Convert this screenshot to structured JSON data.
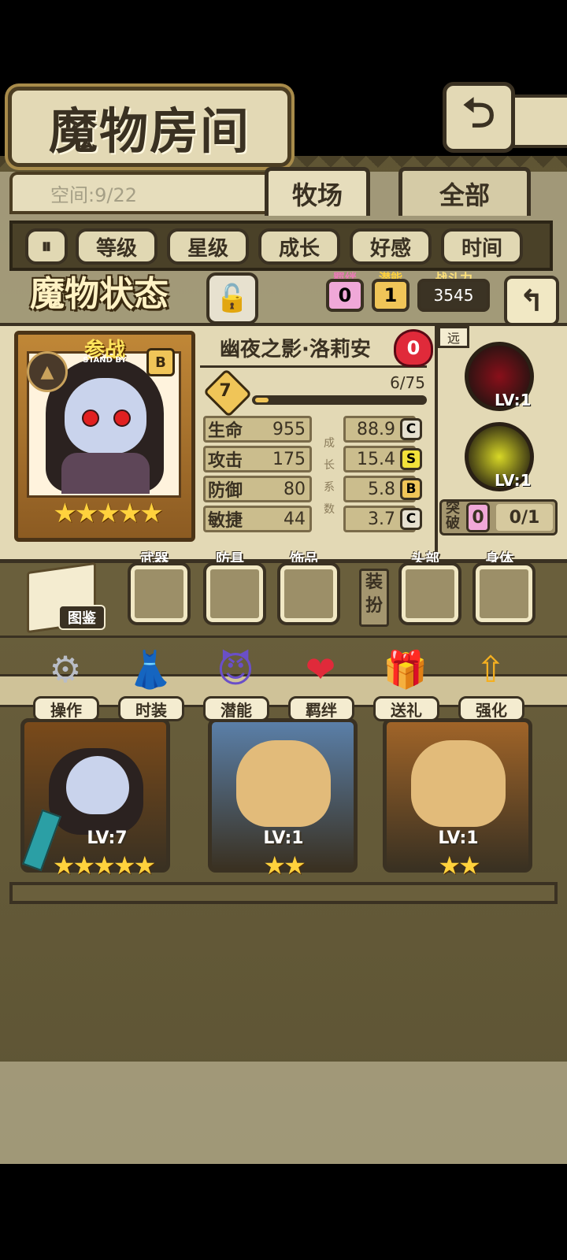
{
  "header": {
    "title": "魔物房间",
    "back_icon": "return-icon"
  },
  "room": {
    "space_label": "空间:9/22"
  },
  "tabs": [
    {
      "label": "牧场",
      "active": true
    },
    {
      "label": "全部",
      "active": false
    }
  ],
  "filters": {
    "toggle_icon": "sort-toggle-icon",
    "items": [
      "等级",
      "星级",
      "成长",
      "好感",
      "时间"
    ]
  },
  "status": {
    "title": "魔物状态",
    "bond_label": "羁绊",
    "bond_value": "0",
    "potential_label": "潜能",
    "potential_value": "1",
    "power_label": "战斗力",
    "power_value": "3545"
  },
  "monster": {
    "standby_label": "参战",
    "standby_sub": "STAND BY",
    "grade": "B",
    "name": "幽夜之影·洛莉安",
    "heart_value": "0",
    "level": "7",
    "exp_text": "6/75",
    "exp_fraction": 0.08,
    "stars": "★★★★★",
    "stats": [
      {
        "name": "生命",
        "value": "955",
        "growth": "88.9",
        "grade": "C",
        "grade_color": "#e6e0d0"
      },
      {
        "name": "攻击",
        "value": "175",
        "growth": "15.4",
        "grade": "S",
        "grade_color": "#f2e23a"
      },
      {
        "name": "防御",
        "value": "80",
        "growth": "5.8",
        "grade": "B",
        "grade_color": "#f0c558"
      },
      {
        "name": "敏捷",
        "value": "44",
        "growth": "3.7",
        "grade": "C",
        "grade_color": "#e6e0d0"
      }
    ],
    "growth_chars": [
      "成",
      "长",
      "系",
      "数"
    ]
  },
  "skills": {
    "range_tag": "远",
    "items": [
      {
        "icon": "bat-skill-icon",
        "level": "LV:1",
        "color": "#8a0f1a"
      },
      {
        "icon": "fireball-skill-icon",
        "level": "LV:1",
        "color": "#d8d826"
      }
    ],
    "break_label": "突破",
    "break_count": "0",
    "break_value": "0/1"
  },
  "equipment": {
    "book_label": "图鉴",
    "weapon": "武器",
    "armor": "防具",
    "accessory": "饰品",
    "dress_label": "装扮",
    "head": "头部",
    "body": "身体"
  },
  "actions": [
    {
      "label": "操作",
      "icon": "gear-icon",
      "glyph": "⚙",
      "color": "#b9bdc6"
    },
    {
      "label": "时装",
      "icon": "outfit-icon",
      "glyph": "👗",
      "color": "#f4a8d8"
    },
    {
      "label": "潜能",
      "icon": "potential-demon-icon",
      "glyph": "😈",
      "color": "#6a4fc8"
    },
    {
      "label": "羁绊",
      "icon": "hearts-icon",
      "glyph": "❤",
      "color": "#e02a3a"
    },
    {
      "label": "送礼",
      "icon": "gift-icon",
      "glyph": "🎁",
      "color": "#e9c23a"
    },
    {
      "label": "强化",
      "icon": "upgrade-arrows-icon",
      "glyph": "⇧",
      "color": "#f5b020"
    }
  ],
  "monster_list": [
    {
      "level": "LV:7",
      "stars": "★★★★★",
      "frame": "#7a4a1a"
    },
    {
      "level": "LV:1",
      "stars": "★★",
      "frame": "#5a7fa8"
    },
    {
      "level": "LV:1",
      "stars": "★★",
      "frame": "#a06428"
    }
  ]
}
